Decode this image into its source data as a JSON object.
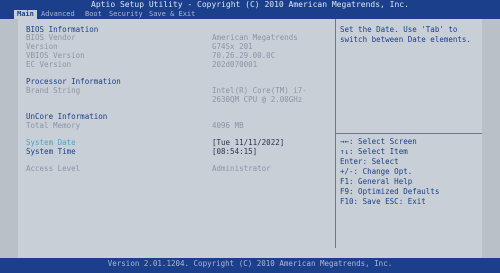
{
  "title_bar": "Aptio Setup Utility - Copyright (C) 2010 American Megatrends, Inc.",
  "tabs": [
    {
      "label": "Main",
      "active": true
    },
    {
      "label": "Advanced"
    },
    {
      "label": "Boot"
    },
    {
      "label": "Security"
    },
    {
      "label": "Save & Exit"
    }
  ],
  "main": {
    "bios_info_heading": "BIOS Information",
    "bios_vendor_label": "BIOS Vendor",
    "bios_vendor_value": "American Megatrends",
    "version_label": "Version",
    "version_value": "G74Sx 201",
    "vbios_label": "VBIOS Version",
    "vbios_value": "70.26.29.00.0C",
    "ec_label": "EC Version",
    "ec_value": "202d070001",
    "processor_heading": "Processor Information",
    "brand_label": "Brand String",
    "brand_value_1": "Intel(R) Core(TM) i7-",
    "brand_value_2": "2630QM CPU @ 2.00GHz",
    "uncore_heading": "UnCore Information",
    "memory_label": "Total Memory",
    "memory_value": "4096 MB",
    "date_label": "System Date",
    "date_value": "[Tue 11/11/2022]",
    "time_label": "System Time",
    "time_value": "[08:54:15]",
    "access_label": "Access Level",
    "access_value": "Administrator"
  },
  "help": {
    "description": "Set the Date. Use 'Tab' to switch between Date elements.",
    "keys": [
      "→←: Select Screen",
      "↑↓: Select Item",
      "Enter: Select",
      "+/-: Change Opt.",
      "F1: General Help",
      "F9: Optimized Defaults",
      "F10: Save  ESC: Exit"
    ]
  },
  "footer": "Version 2.01.1204. Copyright (C) 2010 American Megatrends, Inc."
}
